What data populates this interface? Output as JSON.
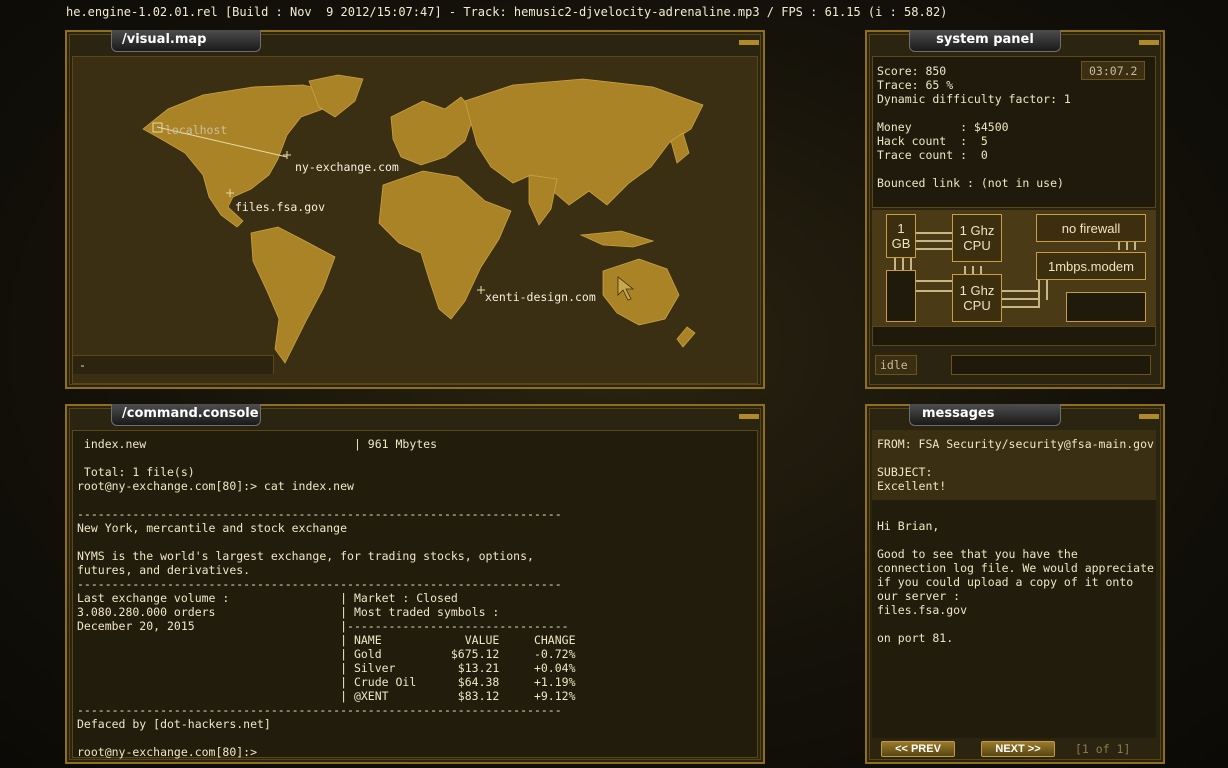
{
  "topbar": {
    "text": "he.engine-1.02.01.rel [Build : Nov  9 2012/15:07:47] - Track: hemusic2-djvelocity-adrenaline.mp3 / FPS : 61.15 (i : 58.82)"
  },
  "visual_map": {
    "title": "/visual.map",
    "labels": {
      "localhost": "localhost",
      "ny": "ny-exchange.com",
      "fsa": "files.fsa.gov",
      "xenti": "xenti-design.com"
    },
    "status": "-"
  },
  "system_panel": {
    "title": "system panel",
    "timer": "03:07.2",
    "lines": [
      "Score: 850",
      "Trace: 65 %",
      "Dynamic difficulty factor: 1",
      "",
      "Money       : $4500",
      "Hack count  :  5",
      "Trace count :  0",
      "",
      "Bounced link : (not in use)"
    ],
    "hardware": {
      "ram": "1\nGB",
      "cpu1": "1 Ghz\nCPU",
      "cpu2": "1 Ghz\nCPU",
      "firewall": "no firewall",
      "modem": "1mbps.modem"
    },
    "status": "idle"
  },
  "console": {
    "title": "/command.console",
    "lines": [
      " index.new                              | 961 Mbytes",
      "",
      " Total: 1 file(s)",
      "root@ny-exchange.com[80]:> cat index.new",
      "",
      "----------------------------------------------------------------------",
      "New York, mercantile and stock exchange",
      "",
      "NYMS is the world's largest exchange, for trading stocks, options,",
      "futures, and derivatives.",
      "----------------------------------------------------------------------",
      "Last exchange volume :                | Market : Closed",
      "3.080.280.000 orders                  | Most traded symbols :",
      "December 20, 2015                     |--------------------------------",
      "                                      | NAME            VALUE     CHANGE",
      "                                      | Gold          $675.12     -0.72%",
      "                                      | Silver         $13.21     +0.04%",
      "                                      | Crude Oil      $64.38     +1.19%",
      "                                      | @XENT          $83.12     +9.12%",
      "----------------------------------------------------------------------",
      "Defaced by [dot-hackers.net]",
      "",
      "root@ny-exchange.com[80]:>"
    ]
  },
  "messages": {
    "title": "messages",
    "header": [
      "FROM: FSA Security/security@fsa-main.gov",
      "",
      "SUBJECT:",
      "Excellent!"
    ],
    "body": [
      "Hi Brian,",
      "",
      "Good to see that you have the",
      "connection log file. We would appreciate",
      "if you could upload a copy of it onto",
      "our server :",
      "files.fsa.gov",
      "",
      "on port 81."
    ],
    "prev": "<< PREV",
    "next": "NEXT >>",
    "pager": "[1 of 1]"
  }
}
